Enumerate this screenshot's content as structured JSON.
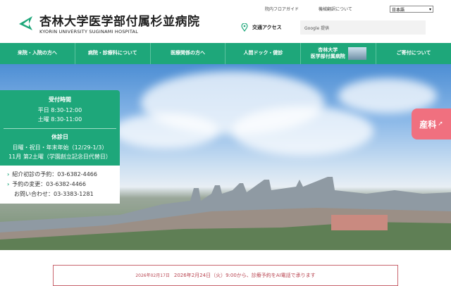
{
  "header": {
    "title": "杏林大学医学部付属杉並病院",
    "subtitle": "KYORIN UNIVERSITY SUGINAMI HOSPITAL",
    "floor_guide": "院内フロアガイド",
    "translation": "機械翻訳について",
    "language": "日本語",
    "access": "交通アクセス",
    "search_placeholder": "Google 提供"
  },
  "nav": [
    "来院・入院の方へ",
    "病院・診療科について",
    "医療関係の方へ",
    "人間ドック・健診",
    "杏林大学",
    "医学部付属病院",
    "ご寄付について"
  ],
  "info": {
    "hours_title": "受付時間",
    "weekday": "平日 8:30-12:00",
    "saturday": "土曜 8:30-11:00",
    "closed_title": "休診日",
    "closed1": "日曜・祝日・年末年始（12/29-1/3）",
    "closed2": "11月 第2土曜（学園創立記念日代替日）",
    "phone1": "紹介初診の予約：03-6382-4466",
    "phone2": "予約の変更：03-6382-4466",
    "phone3": "お問い合わせ：03-3383-1281"
  },
  "side_tab": "産科",
  "notice": {
    "date": "2026年02月17日",
    "text": "2026年2月24日（火）9:00から、診療予約をAI電話で承ります"
  },
  "colors": {
    "green": "#1ea77a",
    "pink": "#f0707f"
  }
}
